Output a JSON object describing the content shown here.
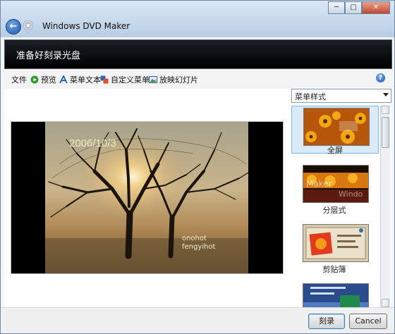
{
  "window": {
    "title": "Windows DVD Maker",
    "controls": {
      "minimize": "─",
      "maximize": "□",
      "close": "✕"
    }
  },
  "banner": {
    "title": "准备好刻录光盘"
  },
  "toolbar": {
    "items": [
      {
        "label": "文件",
        "icon": ""
      },
      {
        "label": "预览",
        "icon": "play-icon"
      },
      {
        "label": "菜单文本",
        "icon": "text-a-icon"
      },
      {
        "label": "自定义菜单",
        "icon": "customize-menu-icon"
      },
      {
        "label": "放映幻灯片",
        "icon": "slideshow-icon"
      }
    ],
    "help": "?"
  },
  "preview": {
    "date_text": "2006/10/3",
    "caption_line1": "onohot",
    "caption_line2": "fengyihot"
  },
  "menu_styles": {
    "select_value": "菜单样式",
    "items": [
      {
        "label": "全屏",
        "selected": true
      },
      {
        "label": "分层式",
        "selected": false
      },
      {
        "label": "剪贴簿",
        "selected": false
      },
      {
        "label": "",
        "selected": false
      }
    ]
  },
  "footer": {
    "burn_label": "刻录",
    "cancel_label": "Cancel"
  }
}
